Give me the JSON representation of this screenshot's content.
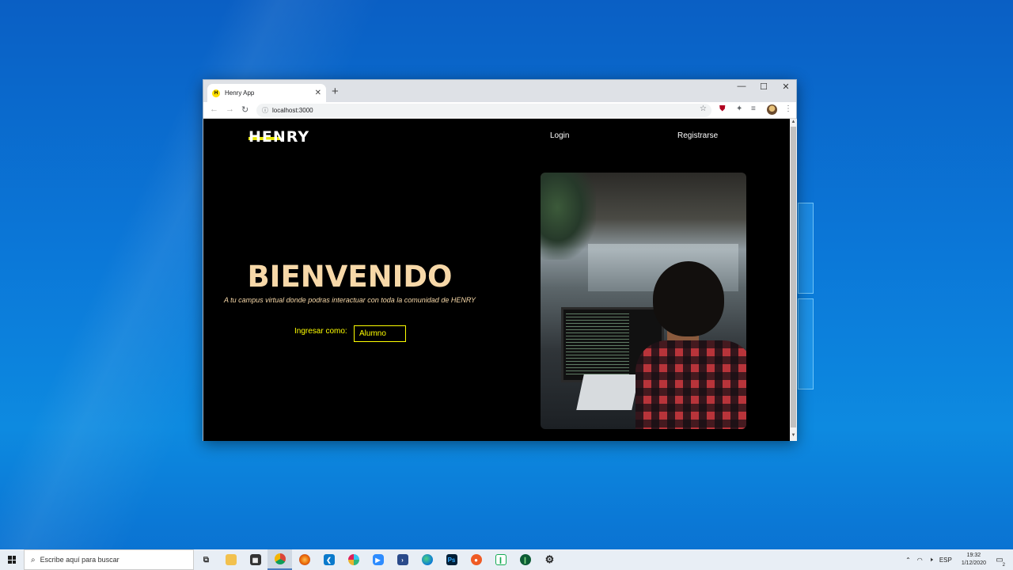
{
  "browser": {
    "tab_title": "Henry App",
    "tab_favicon": "H",
    "address": "localhost:3000",
    "new_tab": "+",
    "minimize": "—",
    "maximize": "☐",
    "close": "✕"
  },
  "page": {
    "logo": "HENRY",
    "nav": {
      "login": "Login",
      "register": "Registrarse"
    },
    "hero_title": "BIENVENIDO",
    "hero_subtitle": "A tu campus virtual donde podras interactuar con toda la comunidad de HENRY",
    "ingresar_label": "Ingresar como:",
    "role_selected": "Alumno"
  },
  "colors": {
    "accent_yellow": "#ffff01",
    "title_cream": "#f7d8a8",
    "background": "#000000"
  },
  "taskbar": {
    "search_placeholder": "Escribe aquí para buscar",
    "apps": [
      "task-view-icon",
      "file-explorer-icon",
      "store-icon",
      "chrome-icon",
      "firefox-icon",
      "vscode-icon",
      "slack-icon",
      "zoom-icon",
      "powershell-icon",
      "edge-icon",
      "photoshop-icon",
      "postman-icon",
      "mongodb-compass-icon",
      "mongodb-icon",
      "settings-icon"
    ],
    "language": "ESP",
    "time": "19:32",
    "date": "1/12/2020",
    "notifications": "2"
  }
}
